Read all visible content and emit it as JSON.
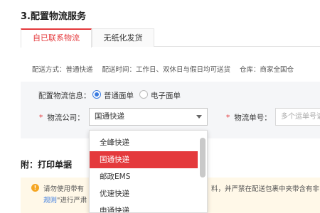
{
  "section_title": "3.配置物流服务",
  "tabs": [
    {
      "label": "自已联系物流",
      "active": true
    },
    {
      "label": "无纸化发货",
      "active": false
    }
  ],
  "info": {
    "delivery_method": "配送方式：普通快递",
    "delivery_time": "配送时间：工作日、双休日与假日均可送货",
    "warehouse": "仓库：商家全国仓"
  },
  "config": {
    "label": "配置物流信息：",
    "radio_options": [
      {
        "label": "普通面单",
        "checked": true
      },
      {
        "label": "电子面单",
        "checked": false
      }
    ],
    "company_label": "物流公司：",
    "company_value": "国通快递",
    "tracking_label": "物流单号：",
    "tracking_placeholder": "多个运单号请"
  },
  "dropdown": {
    "options": [
      "全峰快递",
      "国通快递",
      "邮政EMS",
      "优速快递",
      "申通快递"
    ],
    "selected": "国通快递"
  },
  "print_title": "附：打印单据",
  "notice": {
    "line1_start": "请勿使用带有",
    "line1_end": "料，并严禁在配送包裹中夹带含有非",
    "line2_link": "规则",
    "line2_rest": "\"进行严肃"
  },
  "colors": {
    "accent": "#e4393c",
    "radio_blue": "#3a7be0",
    "warn": "#f5a623"
  }
}
